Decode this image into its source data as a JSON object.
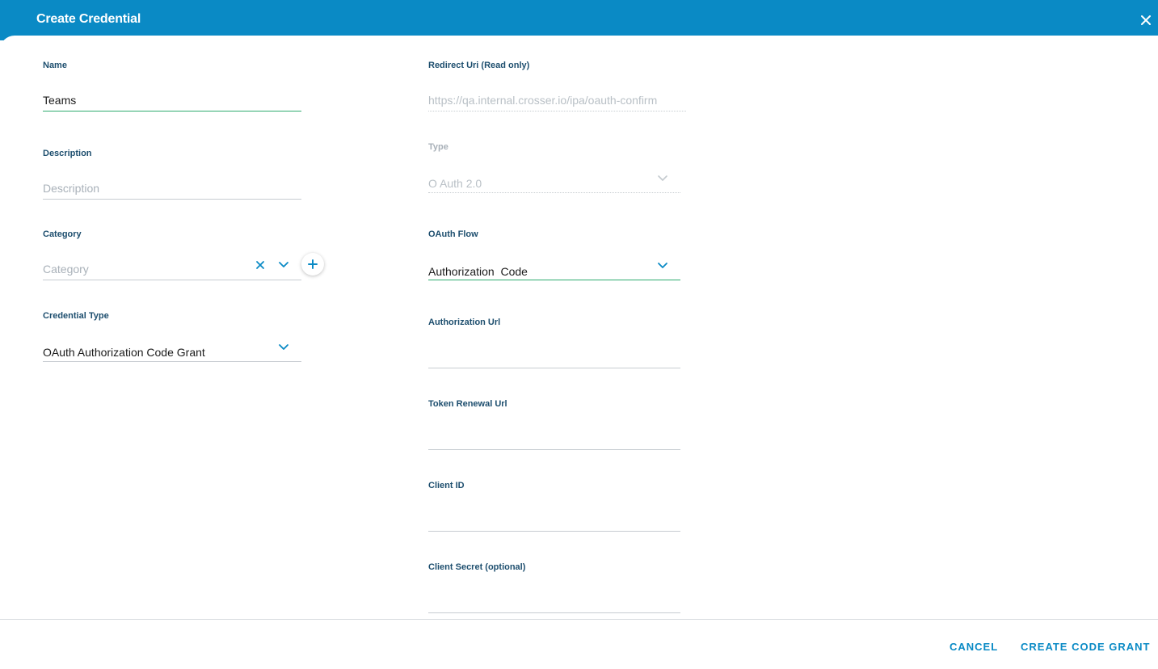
{
  "dialog": {
    "title": "Create Credential"
  },
  "left": {
    "name": {
      "label": "Name",
      "value": "Teams"
    },
    "description": {
      "label": "Description",
      "placeholder": "Description"
    },
    "category": {
      "label": "Category",
      "placeholder": "Category"
    },
    "credential_type": {
      "label": "Credential Type",
      "value": "OAuth Authorization Code Grant"
    }
  },
  "right": {
    "redirect_uri": {
      "label": "Redirect Uri (Read only)",
      "value": "https://qa.internal.crosser.io/ipa/oauth-confirm"
    },
    "type": {
      "label": "Type",
      "value": "O Auth 2.0"
    },
    "oauth_flow": {
      "label": "OAuth Flow",
      "value": "Authorization  Code"
    },
    "authorization_url": {
      "label": "Authorization Url",
      "value": ""
    },
    "token_renewal_url": {
      "label": "Token Renewal Url",
      "value": ""
    },
    "client_id": {
      "label": "Client ID",
      "value": ""
    },
    "client_secret": {
      "label": "Client Secret (optional)",
      "value": ""
    }
  },
  "footer": {
    "cancel_label": "CANCEL",
    "create_label": "CREATE CODE GRANT"
  },
  "colors": {
    "header": "#0a8ac5",
    "accent": "#0a8ac5",
    "label": "#1d4e6e",
    "active_underline": "#2eaa6e"
  },
  "icons": {
    "close": "close-icon",
    "chevron": "chevron-down-icon",
    "clear": "clear-icon",
    "add": "plus-icon"
  }
}
